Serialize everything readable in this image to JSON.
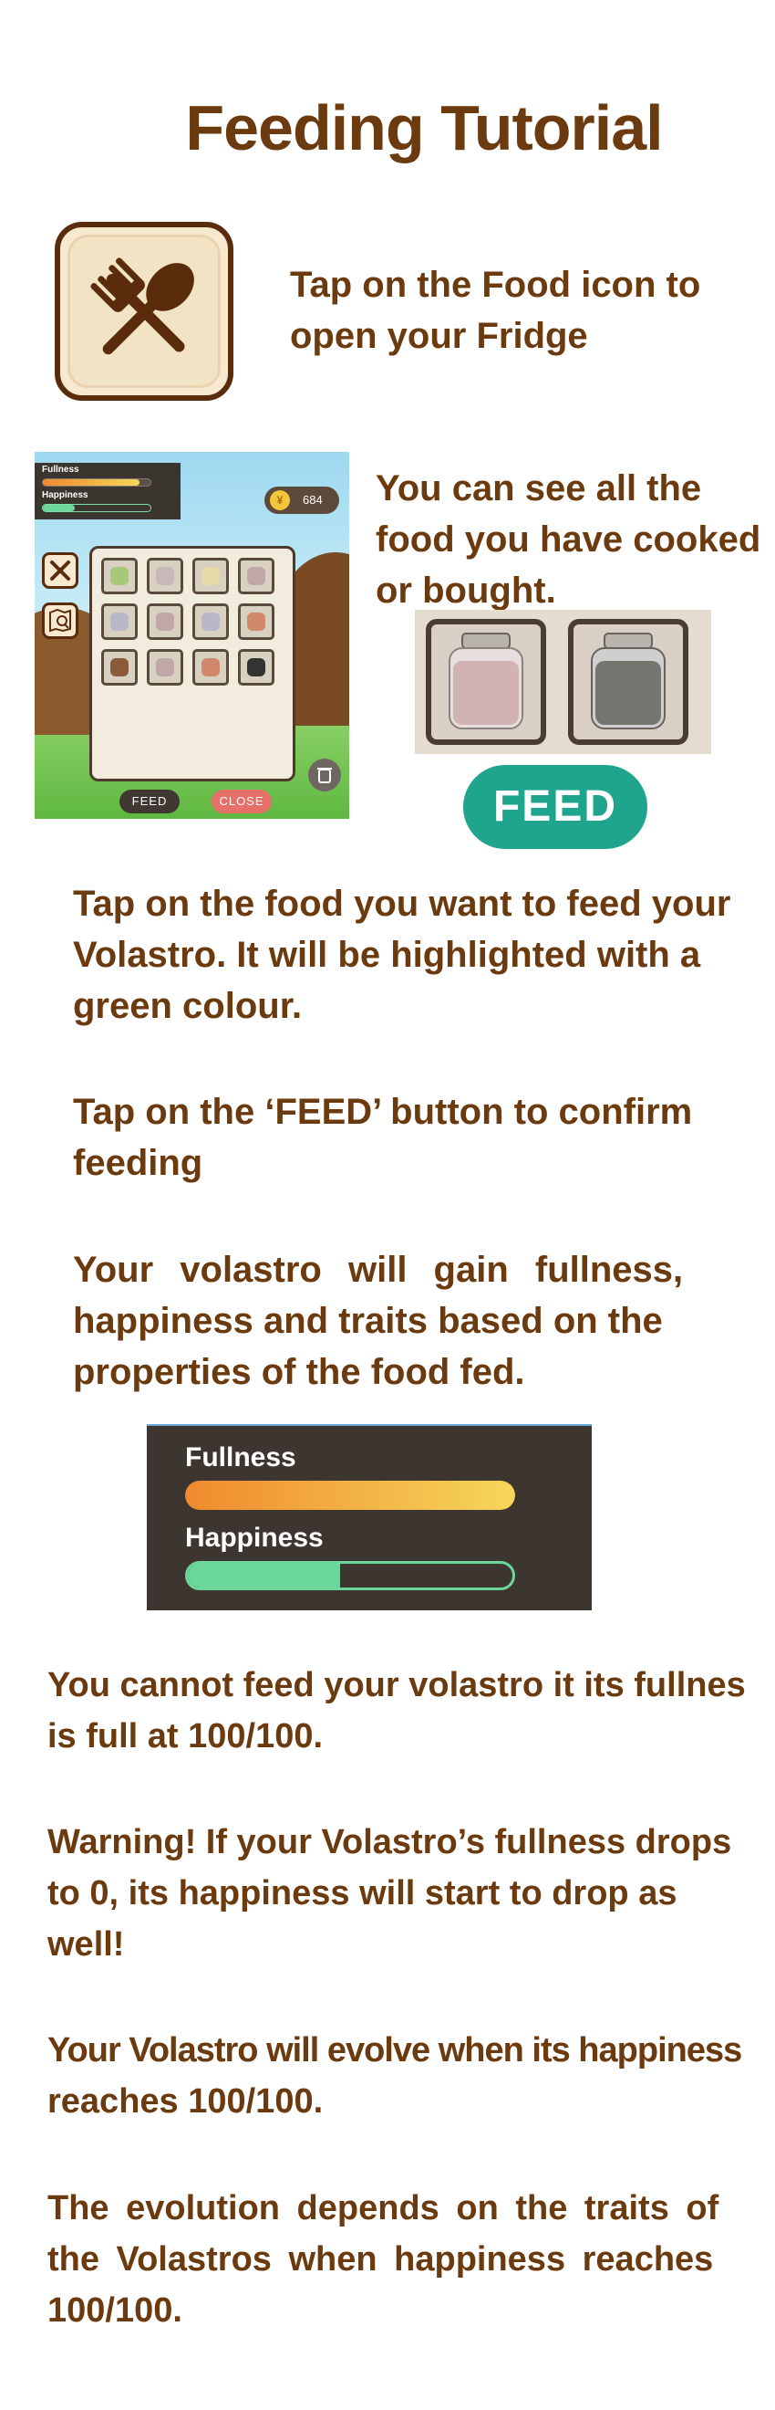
{
  "header": {
    "title": "Feeding Tutorial"
  },
  "colors": {
    "text_brown": "#6b3a0e",
    "feed_green": "#1fa58d",
    "close_red": "#e5706a",
    "fullness_gradient": [
      "#f08a2e",
      "#f5d75a"
    ],
    "happiness_green": "#6cd79a"
  },
  "intro": {
    "food_icon": "fork-spoon-icon",
    "line1": "Tap on the Food icon to",
    "line2": "open your Fridge"
  },
  "fridge_section": {
    "line1": "You can see all the",
    "line2": "food you have cooked",
    "line3": "or bought.",
    "feed_label": "FEED"
  },
  "game_screenshot": {
    "fullness_label": "Fullness",
    "happiness_label": "Happiness",
    "coins": "684",
    "feed_label": "FEED",
    "close_label": "CLOSE",
    "fullness_level": 0.9,
    "happiness_level": 0.3
  },
  "instructions": {
    "p1_l1": "Tap on the food you want to feed your",
    "p1_l2": "Volastro. It will be highlighted with a",
    "p1_l3": "green colour.",
    "p2_l1": "Tap on the ‘FEED’ button to confirm",
    "p2_l2": "feeding",
    "p3_l1": "Your volastro will gain fullness,",
    "p3_l2": "happiness and traits based on the",
    "p3_l3": "properties of the food fed."
  },
  "stats_panel": {
    "fullness_label": "Fullness",
    "happiness_label": "Happiness",
    "fullness_level": 1.0,
    "happiness_level": 0.47
  },
  "notes": {
    "n1_l1": "You cannot feed your volastro it its fullnes",
    "n1_l2": "is full at 100/100.",
    "n2_l1": "Warning! If your Volastro’s fullness drops",
    "n2_l2": "to 0, its happiness will start to drop as",
    "n2_l3": "well!",
    "n3_l1": "Your Volastro will evolve when its happiness",
    "n3_l2": "reaches 100/100.",
    "n4_l1": "The evolution depends on the traits of",
    "n4_l2": "the Volastros when happiness reaches",
    "n4_l3": "100/100."
  }
}
